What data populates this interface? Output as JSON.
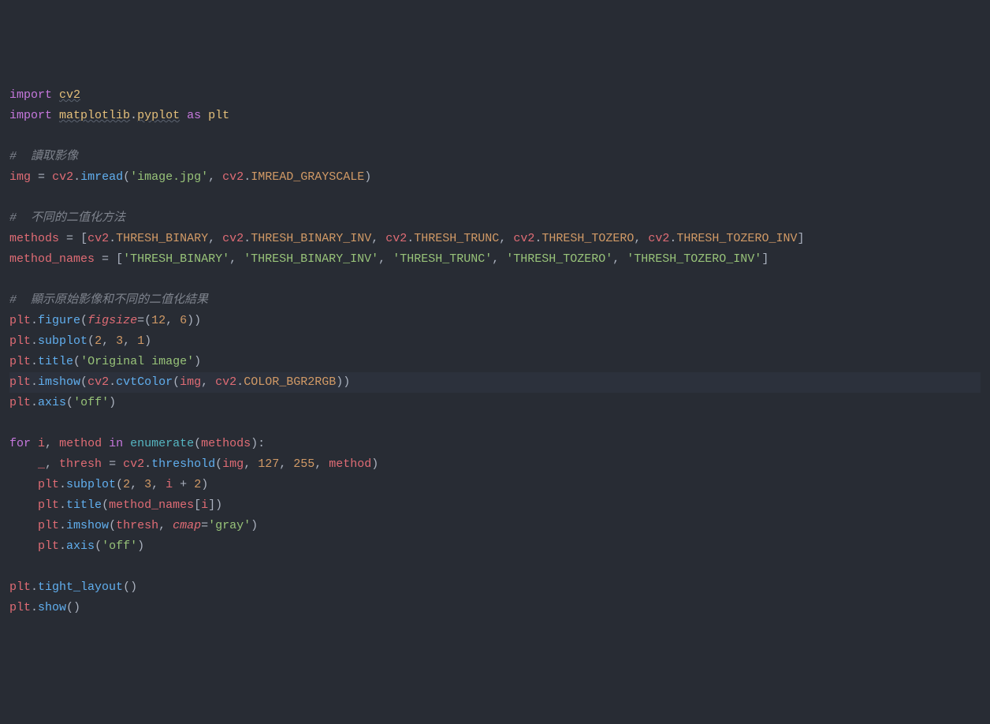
{
  "code": {
    "l1": {
      "kw1": "import",
      "mod1": "cv2"
    },
    "l2": {
      "kw1": "import",
      "mod1": "matplotlib",
      "mod2": "pyplot",
      "kw2": "as",
      "alias": "plt"
    },
    "l4": {
      "cmt": "#  讀取影像"
    },
    "l5": {
      "v1": "img",
      "op": "=",
      "m1": "cv2",
      "fn": "imread",
      "s1": "'image.jpg'",
      "m2": "cv2",
      "c1": "IMREAD_GRAYSCALE"
    },
    "l7": {
      "cmt": "#  不同的二值化方法"
    },
    "l8": {
      "v1": "methods",
      "op": "=",
      "m": "cv2",
      "c1": "THRESH_BINARY",
      "c2": "THRESH_BINARY_INV",
      "c3": "THRESH_TRUNC",
      "c4": "THRESH_TOZERO",
      "c5": "THRESH_TOZERO_INV"
    },
    "l9": {
      "v1": "method_names",
      "op": "=",
      "s1": "'THRESH_BINARY'",
      "s2": "'THRESH_BINARY_INV'",
      "s3": "'THRESH_TRUNC'",
      "s4": "'THRESH_TOZERO'",
      "s5": "'THRESH_TOZERO_INV'"
    },
    "l11": {
      "cmt": "#  顯示原始影像和不同的二值化結果"
    },
    "l12": {
      "m": "plt",
      "fn": "figure",
      "kwarg": "figsize",
      "n1": "12",
      "n2": "6"
    },
    "l13": {
      "m": "plt",
      "fn": "subplot",
      "n1": "2",
      "n2": "3",
      "n3": "1"
    },
    "l14": {
      "m": "plt",
      "fn": "title",
      "s1": "'Original image'"
    },
    "l15": {
      "m": "plt",
      "fn": "imshow",
      "m2": "cv2",
      "fn2": "cvtColor",
      "v1": "img",
      "m3": "cv2",
      "c1": "COLOR_BGR2RGB"
    },
    "l16": {
      "m": "plt",
      "fn": "axis",
      "s1": "'off'"
    },
    "l18": {
      "kw1": "for",
      "v1": "i",
      "v2": "method",
      "kw2": "in",
      "fn": "enumerate",
      "v3": "methods"
    },
    "l19": {
      "v1": "_",
      "v2": "thresh",
      "op": "=",
      "m": "cv2",
      "fn": "threshold",
      "v3": "img",
      "n1": "127",
      "n2": "255",
      "v4": "method"
    },
    "l20": {
      "m": "plt",
      "fn": "subplot",
      "n1": "2",
      "n2": "3",
      "v1": "i",
      "op": "+",
      "n3": "2"
    },
    "l21": {
      "m": "plt",
      "fn": "title",
      "v1": "method_names",
      "v2": "i"
    },
    "l22": {
      "m": "plt",
      "fn": "imshow",
      "v1": "thresh",
      "kwarg": "cmap",
      "s1": "'gray'"
    },
    "l23": {
      "m": "plt",
      "fn": "axis",
      "s1": "'off'"
    },
    "l25": {
      "m": "plt",
      "fn": "tight_layout"
    },
    "l26": {
      "m": "plt",
      "fn": "show"
    }
  }
}
